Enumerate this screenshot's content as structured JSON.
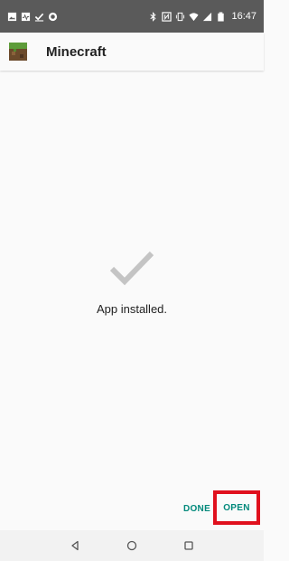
{
  "status_bar": {
    "time": "16:47",
    "left_icons": [
      "image-icon",
      "pulse-icon",
      "check-notification-icon",
      "circle-notification-icon"
    ],
    "right_icons": [
      "bluetooth-icon",
      "nfc-icon",
      "vibrate-icon",
      "wifi-icon",
      "signal-icon",
      "battery-icon"
    ]
  },
  "app_bar": {
    "title": "Minecraft",
    "icon": "minecraft-app-icon"
  },
  "content": {
    "icon": "checkmark-icon",
    "message": "App installed."
  },
  "actions": {
    "done_label": "DONE",
    "open_label": "OPEN"
  },
  "nav_bar": {
    "buttons": [
      "back-icon",
      "home-icon",
      "recents-icon"
    ]
  },
  "colors": {
    "status_bar": "#5a5a5a",
    "accent": "#00897b",
    "highlight": "#e0101d",
    "check": "#c4c4c4"
  }
}
